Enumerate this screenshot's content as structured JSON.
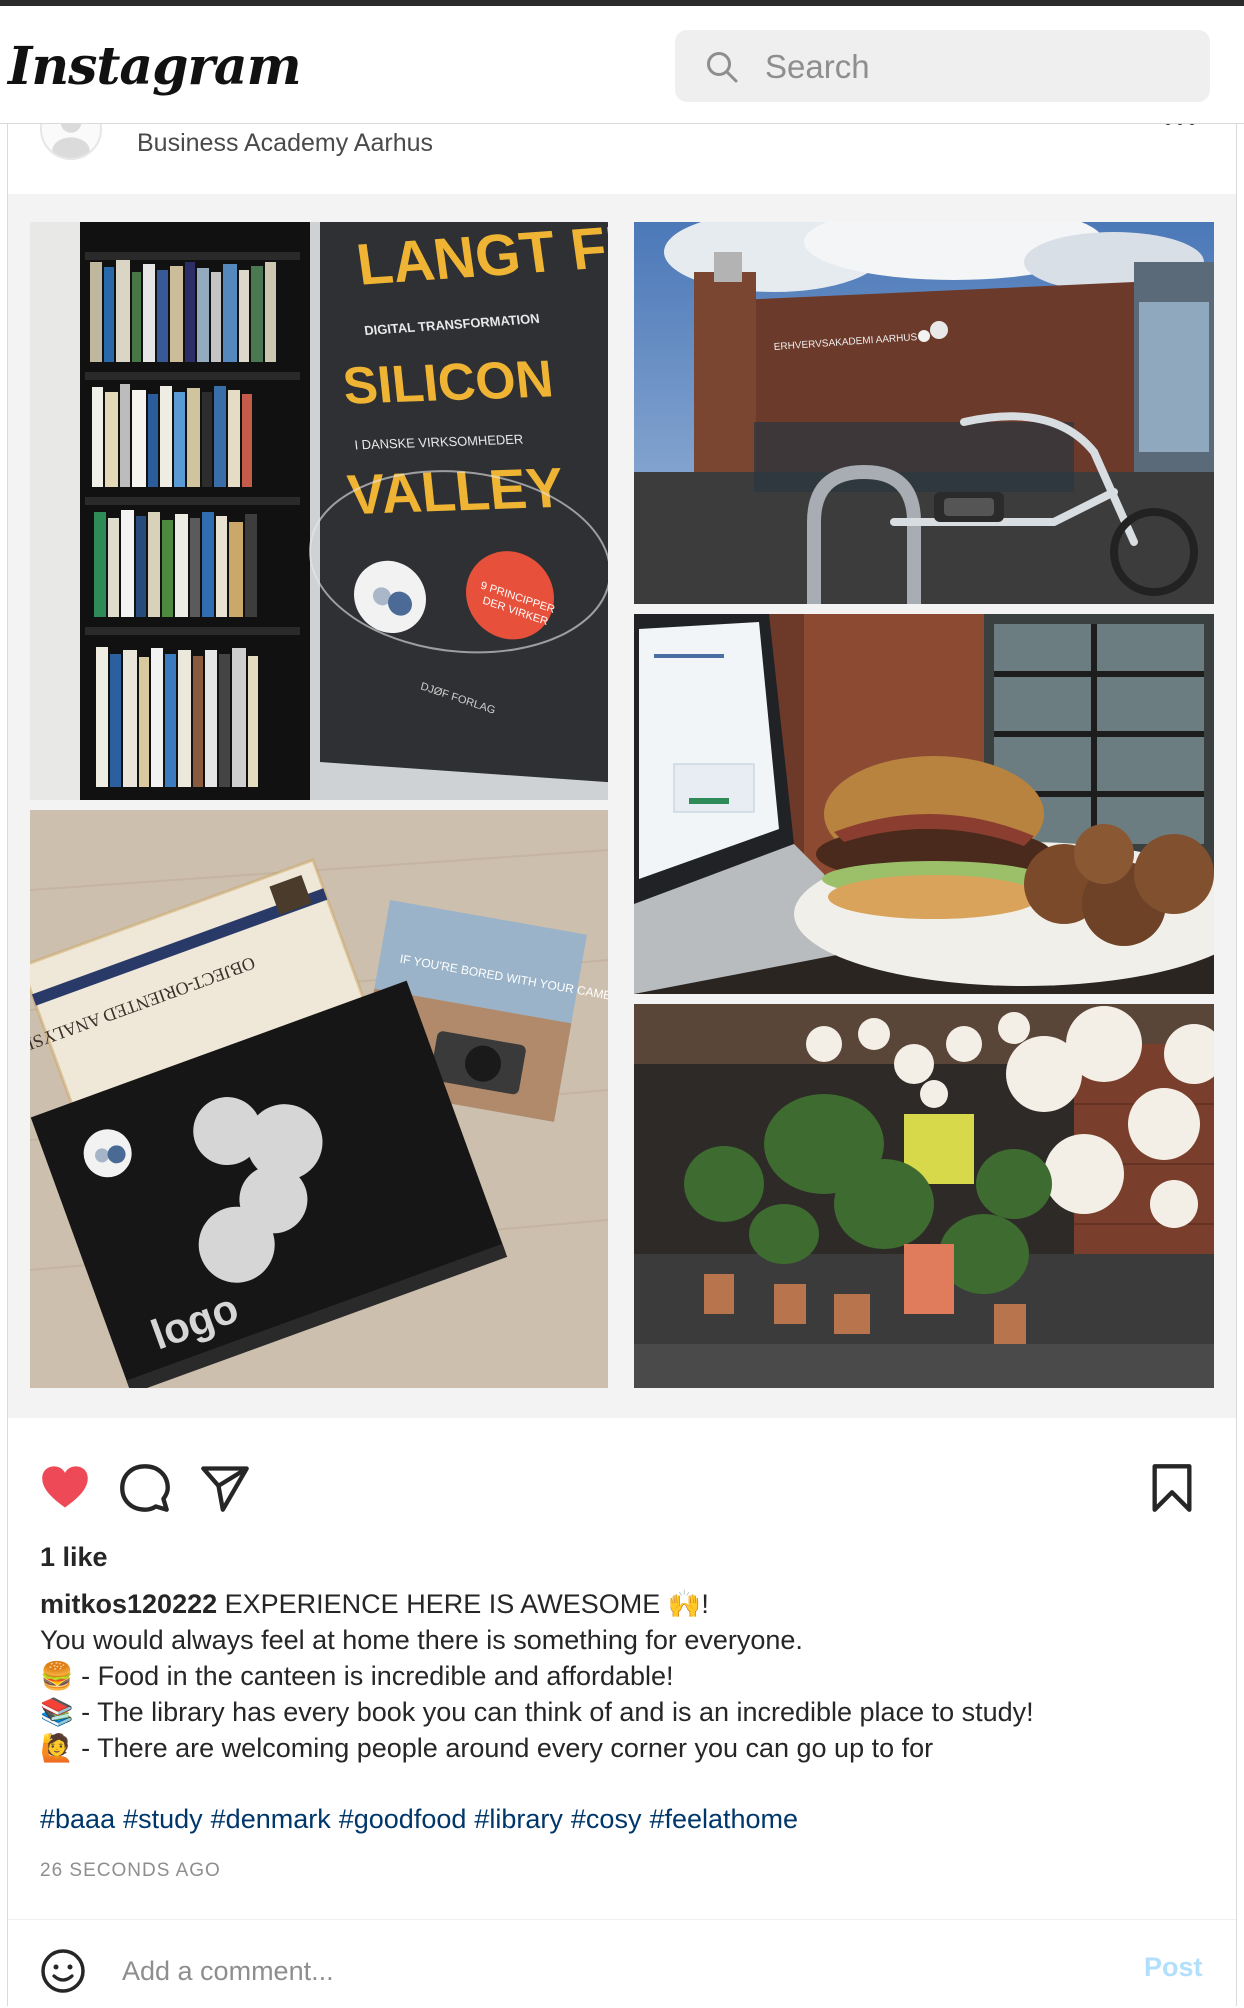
{
  "app": {
    "logo_text": "Instagram"
  },
  "search": {
    "placeholder": "Search",
    "icon": "search-icon"
  },
  "post": {
    "location": "Business Academy Aarhus",
    "images": [
      {
        "name": "library-book-display",
        "book_title": "SILICON VALLEY",
        "book_top": "LANGT FR",
        "book_sub1": "DIGITAL TRANSFORMATION",
        "book_sub2": "I DANSKE VIRKSOMHEDER",
        "badge": "9 PRINCIPPER DER VIRKER",
        "publisher": "DJØF FORLAG"
      },
      {
        "name": "campus-building-exterior",
        "sign": "ERHVERVSAKADEMI AARHUS"
      },
      {
        "name": "burger-and-laptop"
      },
      {
        "name": "books-on-table",
        "book_a": "OBJECT-ORIENTED ANALYSIS AND DESIGN",
        "book_b": "IF YOU'RE BORED WITH YOUR CAMERA READ THIS BOOK",
        "book_c": "logo"
      },
      {
        "name": "canteen-interior"
      }
    ],
    "likes_text": "1 like",
    "caption": {
      "username": "mitkos120222",
      "lines": [
        "EXPERIENCE HERE IS AWESOME 🙌!",
        "You would always feel at home there is something for everyone.",
        "🍔 - Food in the canteen is incredible and affordable!",
        "📚 - The library has every book you can think of and is an incredible place to study!",
        "🙋 - There are welcoming people around every corner you can go up to for"
      ]
    },
    "hashtags": [
      "#baaa",
      "#study",
      "#denmark",
      "#goodfood",
      "#library",
      "#cosy",
      "#feelathome"
    ],
    "timestamp": "26 SECONDS AGO",
    "comment": {
      "placeholder": "Add a comment...",
      "post_label": "Post"
    },
    "colors": {
      "like_active": "#ed4956",
      "hashtag": "#00376b",
      "post_disabled": "#b2dffc"
    }
  }
}
